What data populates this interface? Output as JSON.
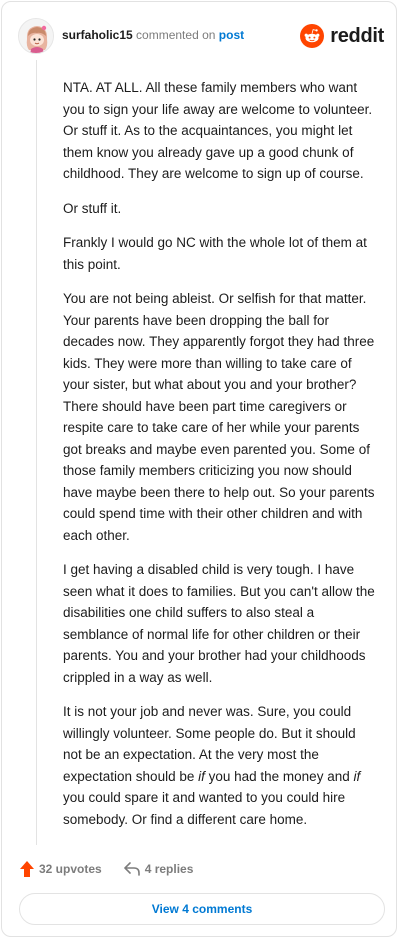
{
  "header": {
    "username": "surfaholic15",
    "action_text": "commented on",
    "post_link": "post",
    "brand_text": "reddit"
  },
  "comment": {
    "paragraphs": [
      "NTA. AT ALL. All these family members who want you to sign your life away are welcome to volunteer. Or stuff it. As to the acquaintances, you might let them know you already gave up a good chunk of childhood. They are welcome to sign up of course.",
      "Or stuff it.",
      "Frankly I would go NC with the whole lot of them at this point.",
      "You are not being ableist. Or selfish for that matter. Your parents have been dropping the ball for decades now. They apparently forgot they had three kids. They were more than willing to take care of your sister, but what about you and your brother? There should have been part time caregivers or respite care to take care of her while your parents got breaks and maybe even parented you. Some of those family members criticizing you now should have maybe been there to help out. So your parents could spend time with their other children and with each other.",
      "I get having a disabled child is very tough. I have seen what it does to families. But you can't allow the disabilities one child suffers to also steal a semblance of normal life for other children or their parents. You and your brother had your childhoods crippled in a way as well."
    ],
    "last_paragraph": {
      "part1": "It is not your job and never was. Sure, you could willingly volunteer. Some people do. But it should not be an expectation. At the very most the expectation should be ",
      "italic1": "if",
      "part2": " you had the money and ",
      "italic2": "if",
      "part3": " you could spare it and wanted to you could hire somebody. Or find a different care home."
    }
  },
  "footer": {
    "upvotes_label": "32 upvotes",
    "replies_label": "4 replies",
    "view_comments_label": "View 4 comments"
  },
  "colors": {
    "upvote": "#ff4500",
    "link": "#0079d3",
    "brand": "#ff4500"
  },
  "icons": {
    "avatar": "snoo-avatar",
    "brand": "reddit-logo-icon",
    "upvote": "upvote-arrow-icon",
    "reply": "reply-arrow-icon"
  }
}
